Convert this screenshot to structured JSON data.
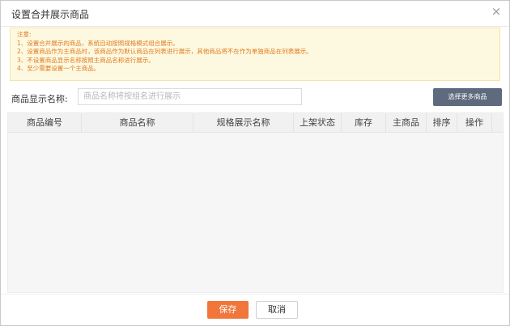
{
  "dialog": {
    "title": "设置合并展示商品",
    "close_icon": "close-icon",
    "close_glyph": "×"
  },
  "notice": {
    "heading": "注意:",
    "lines": [
      "1、设置合并展示的商品，系统自动按照规格模式组合展示。",
      "2、设置商品作为主商品时，该商品作为默认商品在列表进行展示，其他商品将不在作为单独商品在列表展示。",
      "3、不设置商品显示名称按照主商品名称进行展示。",
      "4、至少需要设置一个主商品。"
    ],
    "text_color": "#e07b22",
    "background": "#fdf9e0"
  },
  "form": {
    "name_label": "商品显示名称:",
    "name_placeholder": "商品名称将按组名进行展示",
    "name_value": "",
    "select_more_label": "选择更多商品"
  },
  "table": {
    "columns": [
      "商品编号",
      "商品名称",
      "规格展示名称",
      "上架状态",
      "库存",
      "主商品",
      "排序",
      "操作"
    ],
    "rows": []
  },
  "footer": {
    "save_label": "保存",
    "cancel_label": "取消",
    "save_color": "#f0763b"
  },
  "accent": {
    "select_button_bg": "#5e6a7d"
  }
}
